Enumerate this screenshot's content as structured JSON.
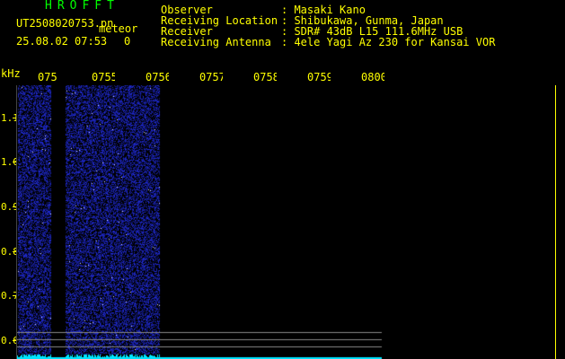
{
  "header": {
    "app_title": "HROFFT",
    "file_name": "UT2508020753.pn",
    "mode": "meteor",
    "date_time": "25.08.02 07:53",
    "count": "0"
  },
  "info": [
    {
      "key": "Observer",
      "value": ": Masaki Kano"
    },
    {
      "key": "Receiving Location",
      "value": ": Shibukawa, Gunma, Japan"
    },
    {
      "key": "Receiver",
      "value": ": SDR# 43dB L15 111.6MHz USB"
    },
    {
      "key": "Receiving Antenna",
      "value": ": 4ele Yagi Az 230 for Kansai VOR"
    }
  ],
  "axis": {
    "y_unit": "kHz",
    "y_ticks": [
      "1.1",
      "1.0",
      "0.9",
      "0.8",
      "0.7",
      "0.6"
    ],
    "x_ticks": [
      "075",
      "0755",
      "0756",
      "0757",
      "0758",
      "0759",
      "0800"
    ]
  },
  "colors": {
    "text": "#ffff00",
    "title": "#00ff00",
    "noise": "#2233cc",
    "baseline": "#00e5ff"
  }
}
